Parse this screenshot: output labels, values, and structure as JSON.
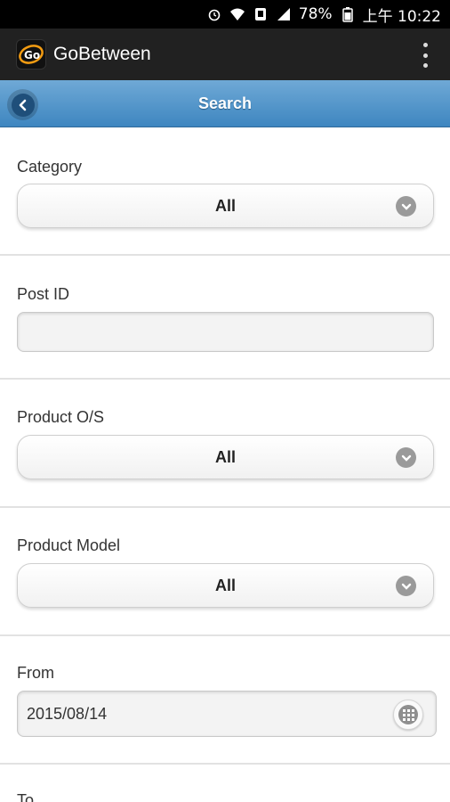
{
  "status_bar": {
    "battery": "78%",
    "time": "上午 10:22",
    "icons": [
      "alarm-icon",
      "wifi-icon",
      "phone-icon",
      "signal-icon",
      "battery-icon"
    ]
  },
  "app_bar": {
    "title": "GoBetween",
    "logo_icon": "gobetween-logo-icon",
    "menu_icon": "overflow-menu-icon"
  },
  "header": {
    "title": "Search",
    "back_icon": "back-arrow-icon"
  },
  "form": {
    "category": {
      "label": "Category",
      "value": "All"
    },
    "post_id": {
      "label": "Post ID",
      "value": ""
    },
    "product_os": {
      "label": "Product O/S",
      "value": "All"
    },
    "product_model": {
      "label": "Product Model",
      "value": "All"
    },
    "from": {
      "label": "From",
      "value": "2015/08/14"
    },
    "to": {
      "label": "To"
    }
  },
  "colors": {
    "header_gradient_top": "#6fa9d6",
    "header_gradient_bottom": "#3e86c0",
    "app_bar": "#212121"
  }
}
